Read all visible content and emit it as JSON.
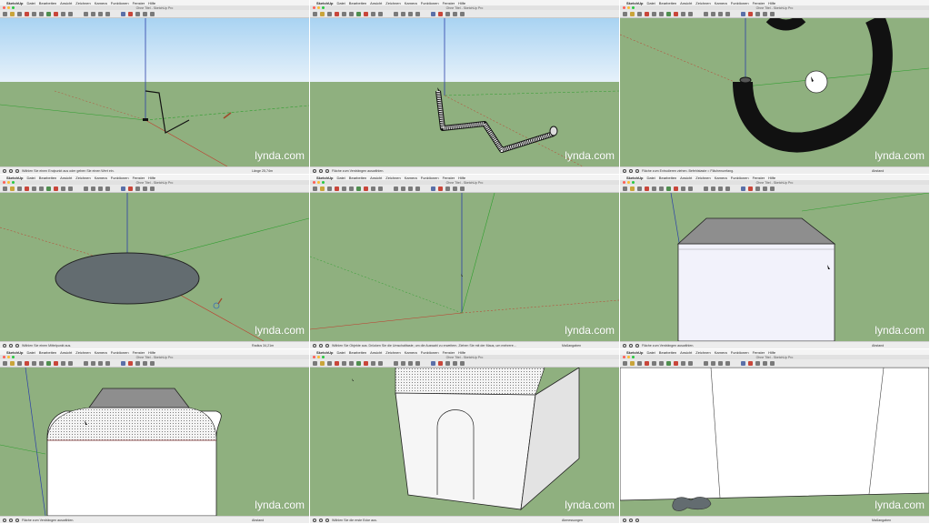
{
  "app": {
    "apple_glyph": "",
    "name": "SketchUp",
    "menus": [
      "Datei",
      "Bearbeiten",
      "Ansicht",
      "Zeichnen",
      "Kamera",
      "Funktionen",
      "Fenster",
      "Hilfe"
    ],
    "window_title": "Ohne Titel - SketchUp Pro"
  },
  "colors": {
    "sky_top": "#a9d3f2",
    "sky_bottom": "#e6f1fa",
    "ground": "#8fb07f",
    "axis_red": "#c0392b",
    "axis_green": "#2e9e2e",
    "axis_blue": "#2b3fa8",
    "traffic_red": "#fc5f57",
    "traffic_yellow": "#fdbc2e",
    "traffic_green": "#28c840"
  },
  "watermark": {
    "brand": "lynda",
    "suffix": ".com"
  },
  "panels": [
    {
      "status": "Wählen Sie einen Endpunkt aus oder geben Sie einen Wert ein.",
      "vcb": "Länge 25,74m"
    },
    {
      "status": "Fläche zum Verdrängen auswählen.",
      "vcb": ""
    },
    {
      "status": "Fläche zum Extrudieren ziehen. Befehlstaste = Flächenumfang.",
      "vcb": "Abstand"
    },
    {
      "status": "Wählen Sie einen Mittelpunkt aus.",
      "vcb": "Radius 34,21m"
    },
    {
      "status": "Wählen Sie Objekte aus. Drücken Sie die Umschalttaste, um die Auswahl zu erweitern. Ziehen Sie mit der Maus, um mehrere...",
      "vcb": "Maßangaben"
    },
    {
      "status": "Fläche zum Verdrängen auswählen.",
      "vcb": "Abstand"
    },
    {
      "status": "Fläche zum Verdrängen auswählen.",
      "vcb": "Abstand"
    },
    {
      "status": "Wählen Sie die erste Ecke aus.",
      "vcb": "Abmessungen"
    },
    {
      "status": "",
      "vcb": "Maßangaben"
    }
  ]
}
